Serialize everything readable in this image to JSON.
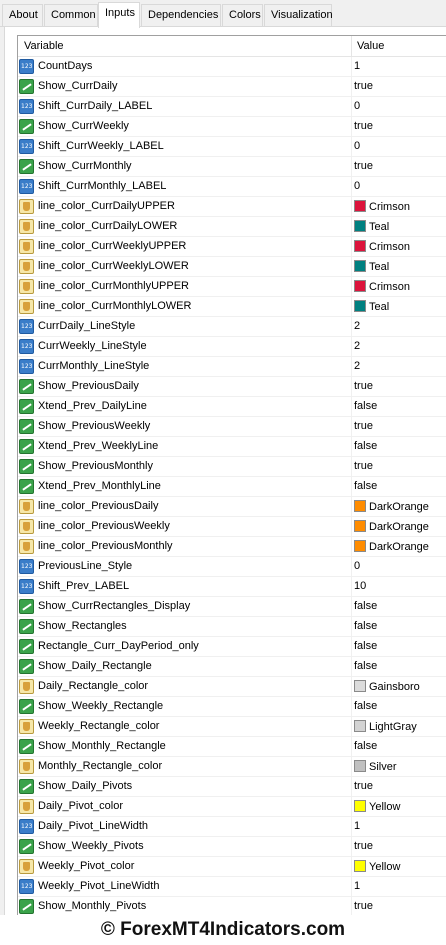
{
  "tabs": [
    {
      "label": "About"
    },
    {
      "label": "Common"
    },
    {
      "label": "Inputs"
    },
    {
      "label": "Dependencies"
    },
    {
      "label": "Colors"
    },
    {
      "label": "Visualization"
    }
  ],
  "active_tab": "Inputs",
  "grid": {
    "header": {
      "variable": "Variable",
      "value": "Value"
    },
    "rows": [
      {
        "type": "number",
        "name": "CountDays",
        "value": "1"
      },
      {
        "type": "bool",
        "name": "Show_CurrDaily",
        "value": "true"
      },
      {
        "type": "number",
        "name": "Shift_CurrDaily_LABEL",
        "value": "0"
      },
      {
        "type": "bool",
        "name": "Show_CurrWeekly",
        "value": "true"
      },
      {
        "type": "number",
        "name": "Shift_CurrWeekly_LABEL",
        "value": "0"
      },
      {
        "type": "bool",
        "name": "Show_CurrMonthly",
        "value": "true"
      },
      {
        "type": "number",
        "name": "Shift_CurrMonthly_LABEL",
        "value": "0"
      },
      {
        "type": "color",
        "name": "line_color_CurrDailyUPPER",
        "value": "Crimson",
        "swatch": "#dc143c"
      },
      {
        "type": "color",
        "name": "line_color_CurrDailyLOWER",
        "value": "Teal",
        "swatch": "#008080"
      },
      {
        "type": "color",
        "name": "line_color_CurrWeeklyUPPER",
        "value": "Crimson",
        "swatch": "#dc143c"
      },
      {
        "type": "color",
        "name": "line_color_CurrWeeklyLOWER",
        "value": "Teal",
        "swatch": "#008080"
      },
      {
        "type": "color",
        "name": "line_color_CurrMonthlyUPPER",
        "value": "Crimson",
        "swatch": "#dc143c"
      },
      {
        "type": "color",
        "name": "line_color_CurrMonthlyLOWER",
        "value": "Teal",
        "swatch": "#008080"
      },
      {
        "type": "number",
        "name": "CurrDaily_LineStyle",
        "value": "2"
      },
      {
        "type": "number",
        "name": "CurrWeekly_LineStyle",
        "value": "2"
      },
      {
        "type": "number",
        "name": "CurrMonthly_LineStyle",
        "value": "2"
      },
      {
        "type": "bool",
        "name": "Show_PreviousDaily",
        "value": "true"
      },
      {
        "type": "bool",
        "name": "Xtend_Prev_DailyLine",
        "value": "false"
      },
      {
        "type": "bool",
        "name": "Show_PreviousWeekly",
        "value": "true"
      },
      {
        "type": "bool",
        "name": "Xtend_Prev_WeeklyLine",
        "value": "false"
      },
      {
        "type": "bool",
        "name": "Show_PreviousMonthly",
        "value": "true"
      },
      {
        "type": "bool",
        "name": "Xtend_Prev_MonthlyLine",
        "value": "false"
      },
      {
        "type": "color",
        "name": "line_color_PreviousDaily",
        "value": "DarkOrange",
        "swatch": "#ff8c00"
      },
      {
        "type": "color",
        "name": "line_color_PreviousWeekly",
        "value": "DarkOrange",
        "swatch": "#ff8c00"
      },
      {
        "type": "color",
        "name": "line_color_PreviousMonthly",
        "value": "DarkOrange",
        "swatch": "#ff8c00"
      },
      {
        "type": "number",
        "name": "PreviousLine_Style",
        "value": "0"
      },
      {
        "type": "number",
        "name": "Shift_Prev_LABEL",
        "value": "10"
      },
      {
        "type": "bool",
        "name": "Show_CurrRectangles_Display",
        "value": "false"
      },
      {
        "type": "bool",
        "name": "Show_Rectangles",
        "value": "false"
      },
      {
        "type": "bool",
        "name": "Rectangle_Curr_DayPeriod_only",
        "value": "false"
      },
      {
        "type": "bool",
        "name": "Show_Daily_Rectangle",
        "value": "false"
      },
      {
        "type": "color",
        "name": "Daily_Rectangle_color",
        "value": "Gainsboro",
        "swatch": "#dcdcdc"
      },
      {
        "type": "bool",
        "name": "Show_Weekly_Rectangle",
        "value": "false"
      },
      {
        "type": "color",
        "name": "Weekly_Rectangle_color",
        "value": "LightGray",
        "swatch": "#d3d3d3"
      },
      {
        "type": "bool",
        "name": "Show_Monthly_Rectangle",
        "value": "false"
      },
      {
        "type": "color",
        "name": "Monthly_Rectangle_color",
        "value": "Silver",
        "swatch": "#c0c0c0"
      },
      {
        "type": "bool",
        "name": "Show_Daily_Pivots",
        "value": "true"
      },
      {
        "type": "color",
        "name": "Daily_Pivot_color",
        "value": "Yellow",
        "swatch": "#ffff00"
      },
      {
        "type": "number",
        "name": "Daily_Pivot_LineWidth",
        "value": "1"
      },
      {
        "type": "bool",
        "name": "Show_Weekly_Pivots",
        "value": "true"
      },
      {
        "type": "color",
        "name": "Weekly_Pivot_color",
        "value": "Yellow",
        "swatch": "#ffff00"
      },
      {
        "type": "number",
        "name": "Weekly_Pivot_LineWidth",
        "value": "1"
      },
      {
        "type": "bool",
        "name": "Show_Monthly_Pivots",
        "value": "true"
      }
    ]
  },
  "footer": {
    "watermark": "© ForexMT4Indicators.com"
  }
}
